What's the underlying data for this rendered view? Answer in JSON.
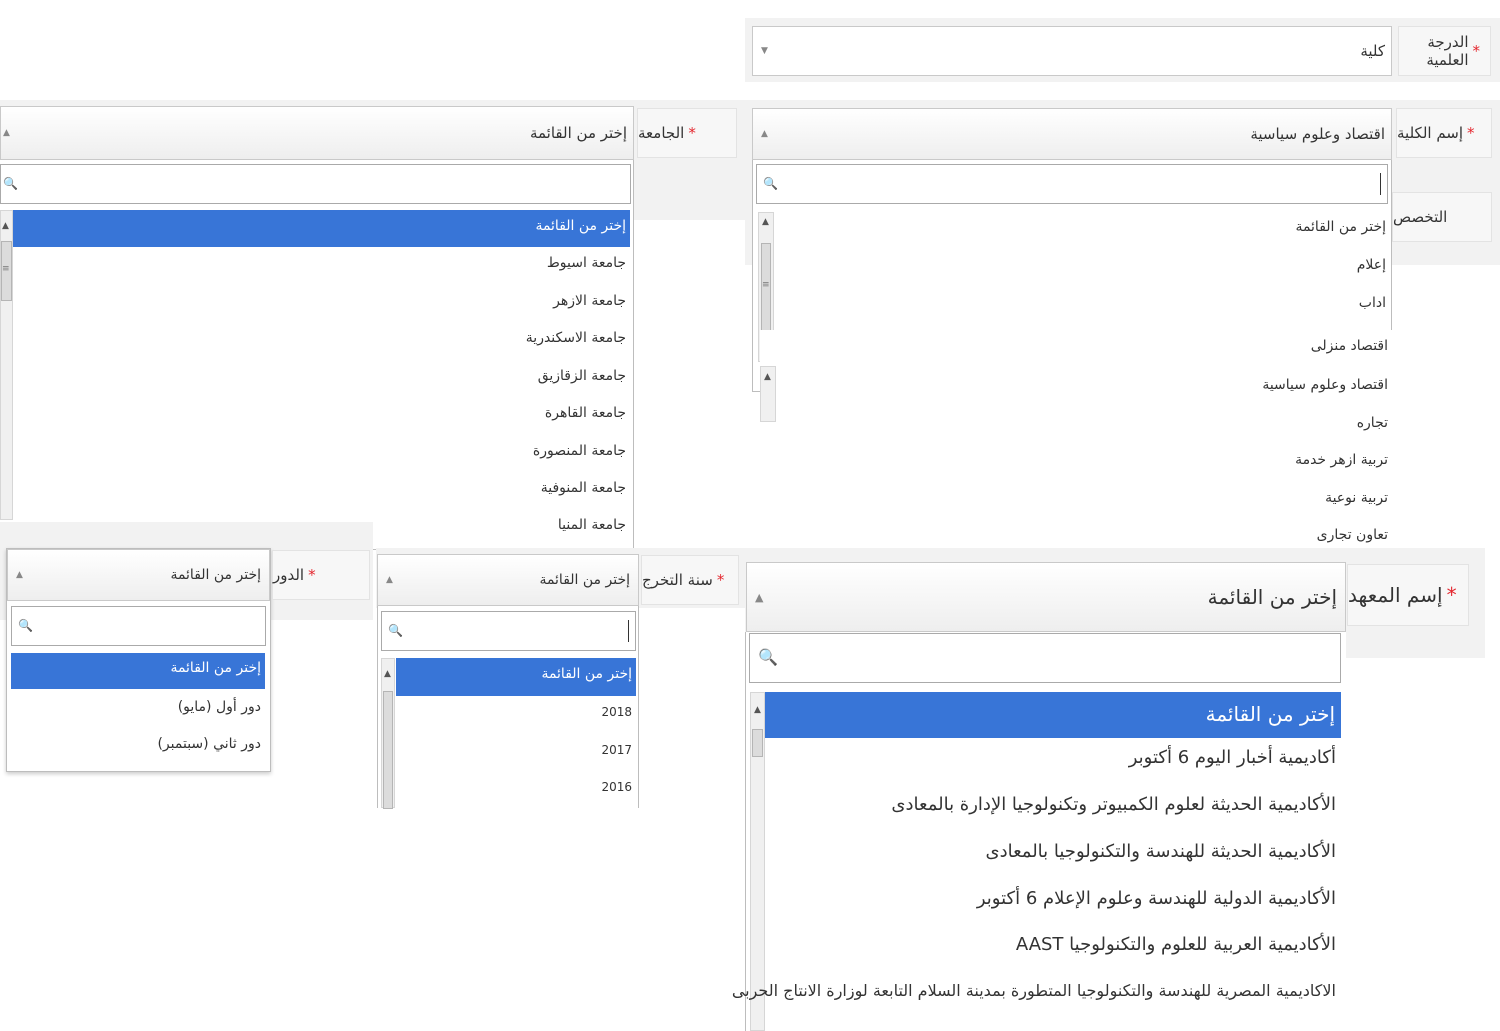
{
  "degree": {
    "label": "الدرجة العلمية",
    "required_mark": "*",
    "value": "كلية",
    "arrow": "▼"
  },
  "faculty": {
    "label": "إسم الكلية",
    "required_mark": "*",
    "value": "اقتصاد وعلوم سياسية",
    "arrow": "▲",
    "options": [
      "إختر من القائمة",
      "إعلام",
      "اداب",
      "اقتصاد منزلى",
      "اقتصاد وعلوم سياسية",
      "تجاره",
      "تربية ازهر خدمة",
      "تربية نوعية",
      "تعاون تجارى"
    ]
  },
  "specialization": {
    "label": "التخصص"
  },
  "university": {
    "label": "الجامعة",
    "required_mark": "*",
    "value": "إختر من القائمة",
    "arrow": "▲",
    "options": [
      "إختر من القائمة",
      "جامعة اسيوط",
      "جامعة الازهر",
      "جامعة الاسكندرية",
      "جامعة الزقازيق",
      "جامعة القاهرة",
      "جامعة المنصورة",
      "جامعة المنوفية",
      "جامعة المنيا"
    ]
  },
  "round": {
    "label": "الدور",
    "required_mark": "*",
    "value": "إختر من القائمة",
    "arrow": "▲",
    "options": [
      "إختر من القائمة",
      "دور أول (مايو)",
      "دور ثاني (سبتمبر)"
    ]
  },
  "grad_year": {
    "label": "سنة التخرج",
    "required_mark": "*",
    "value": "إختر من القائمة",
    "arrow": "▲",
    "options": [
      "إختر من القائمة",
      "2018",
      "2017",
      "2016"
    ]
  },
  "institute": {
    "label": "إسم المعهد",
    "required_mark": "*",
    "value": "إختر من القائمة",
    "arrow": "▲",
    "options": [
      "إختر من القائمة",
      "أكاديمية أخبار اليوم 6 أكتوبر",
      "الأكاديمية الحديثة لعلوم الكمبيوتر وتكنولوجيا الإدارة بالمعادى",
      "الأكاديمية الحديثة للهندسة والتكنولوجيا بالمعادى",
      "الأكاديمية الدولية للهندسة وعلوم الإعلام 6 أكتوبر",
      "الأكاديمية العربية للعلوم والتكنولوجيا AAST",
      "الاكاديمية المصرية للهندسة والتكنولوجيا المتطورة بمدينة السلام التابعة لوزارة الانتاج الحربى"
    ]
  },
  "icons": {
    "search": "🔍",
    "scroll_up": "▲",
    "grip": "≡"
  }
}
